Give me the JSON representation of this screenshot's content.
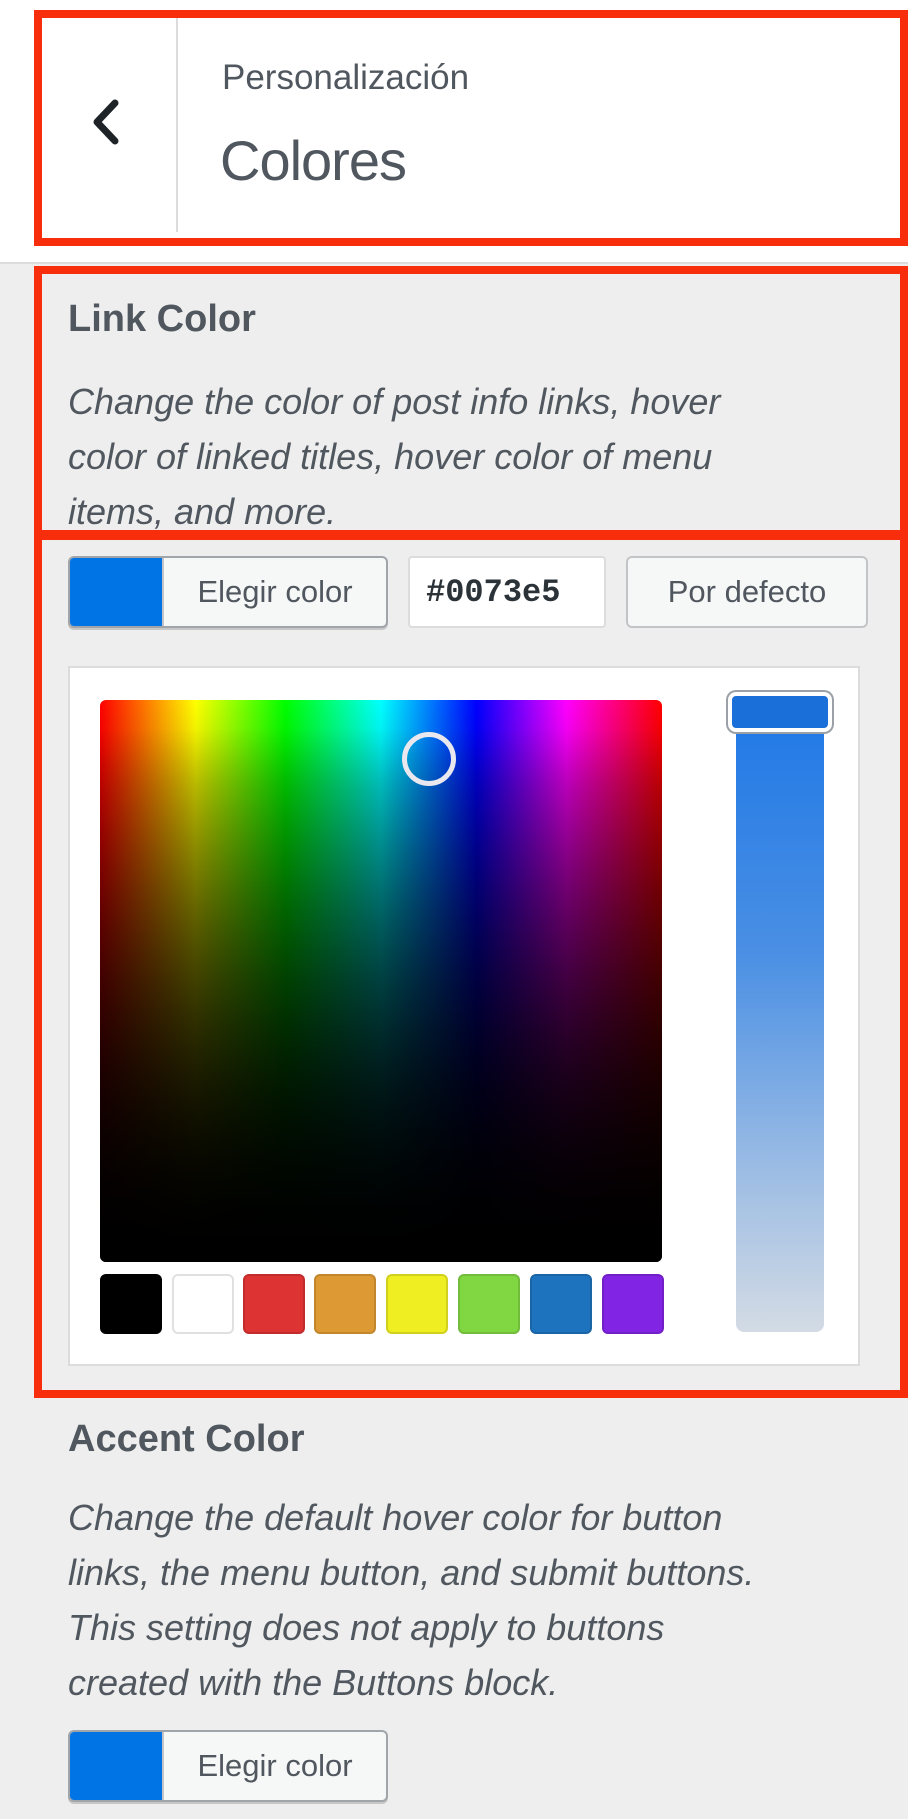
{
  "header": {
    "breadcrumb": "Personalización",
    "title": "Colores"
  },
  "link_color": {
    "title": "Link Color",
    "desc_lines": [
      "Change the color of post info links, hover",
      "color of linked titles, hover color of menu",
      "items, and more."
    ],
    "choose_label": "Elegir color",
    "hex_value": "#0073e5",
    "default_label": "Por defecto",
    "current_color": "#0073e5"
  },
  "palette": [
    {
      "name": "black",
      "color": "#000000"
    },
    {
      "name": "white",
      "color": "#ffffff"
    },
    {
      "name": "red",
      "color": "#dd3333"
    },
    {
      "name": "orange",
      "color": "#dd9933"
    },
    {
      "name": "yellow",
      "color": "#eeee22"
    },
    {
      "name": "green",
      "color": "#81d742"
    },
    {
      "name": "blue",
      "color": "#1e73be"
    },
    {
      "name": "purple",
      "color": "#8224e3"
    }
  ],
  "accent_color": {
    "title": "Accent Color",
    "desc_lines": [
      "Change the default hover color for button",
      "links, the menu button, and submit buttons.",
      "This setting does not apply to buttons",
      "created with the Buttons block."
    ],
    "choose_label": "Elegir color",
    "current_color": "#0073e5"
  },
  "icons": {
    "back": "chevron-left-icon"
  }
}
